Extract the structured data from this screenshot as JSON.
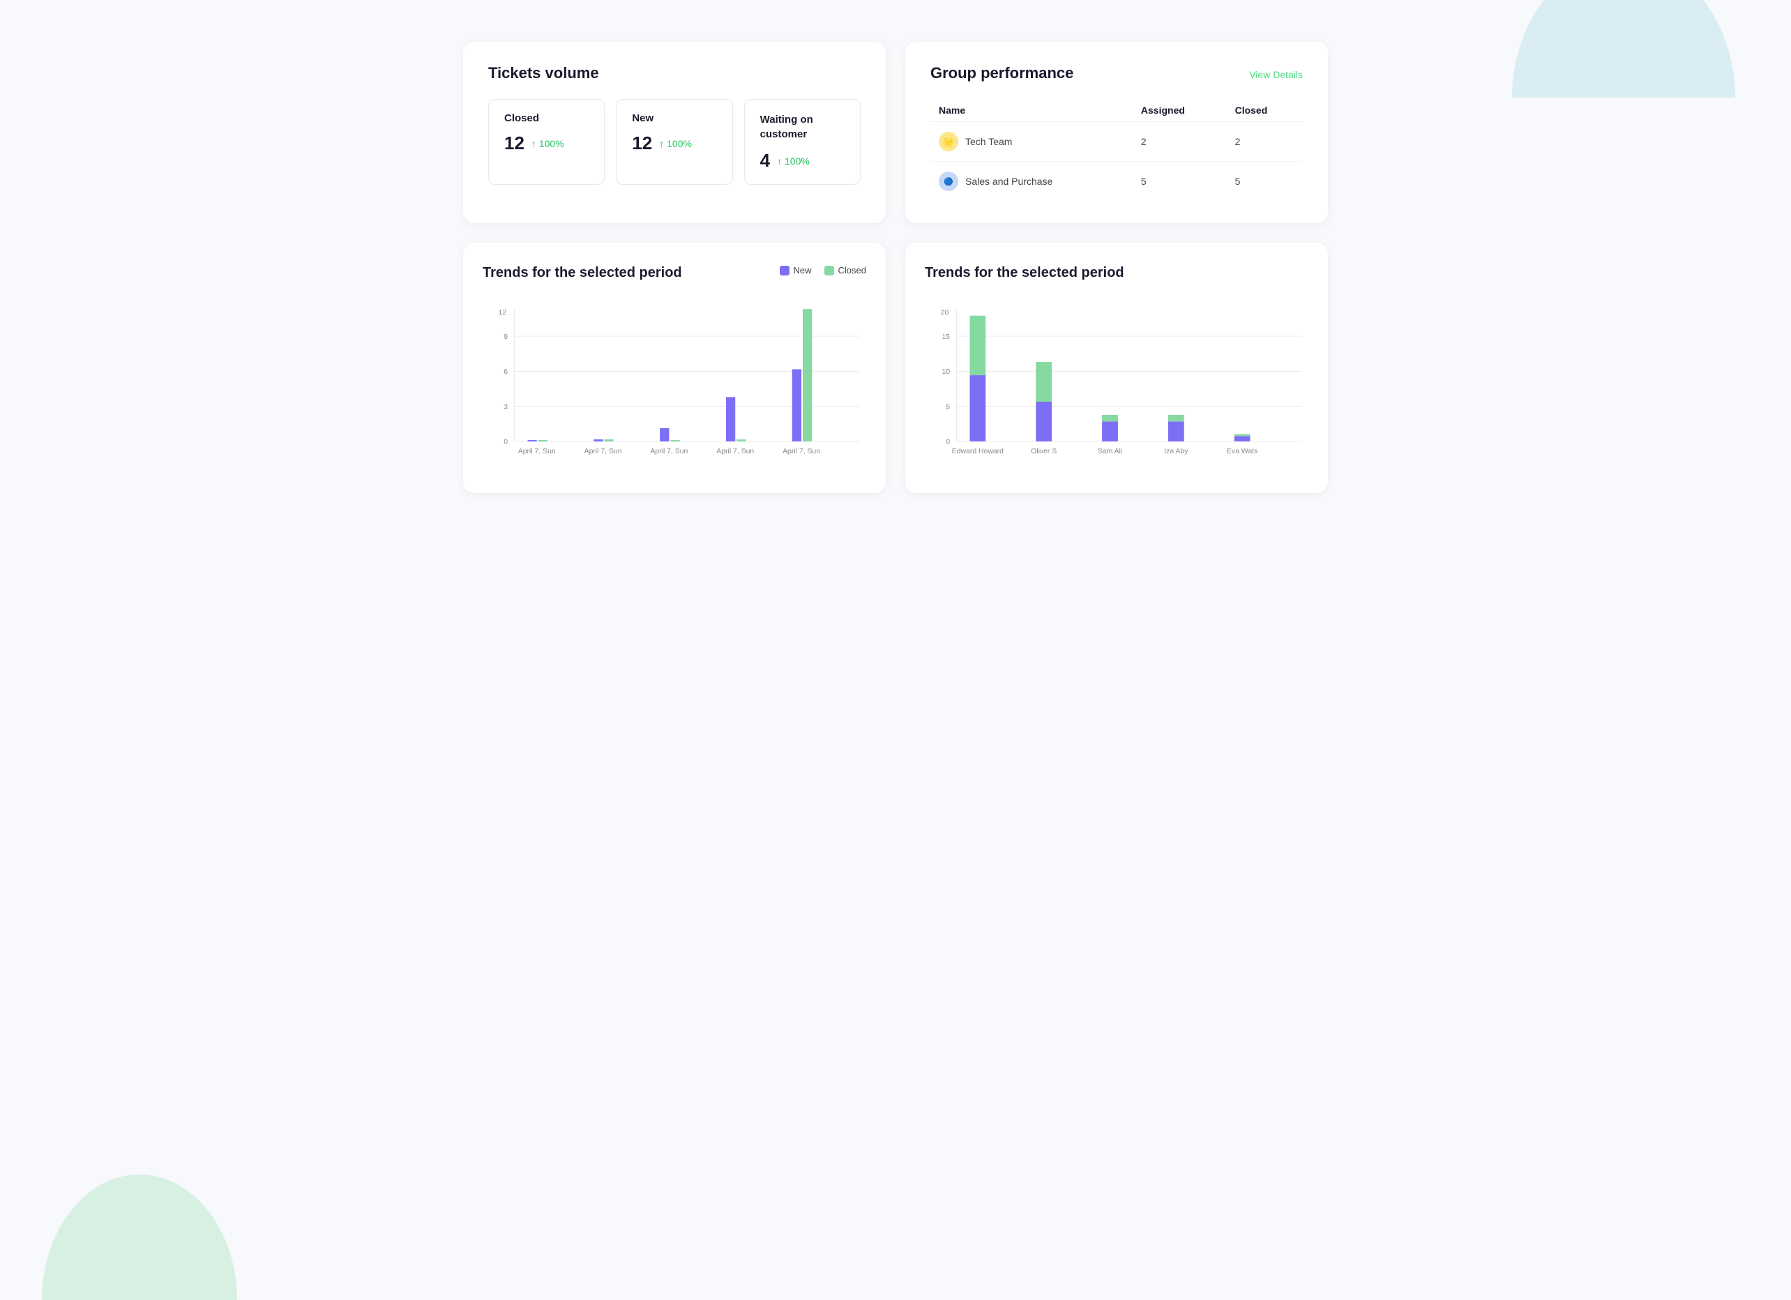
{
  "background": {
    "circle_top_right": "decorative",
    "circle_bottom_left": "decorative"
  },
  "tickets_volume": {
    "title": "Tickets volume",
    "metrics": [
      {
        "label": "Closed",
        "value": "12",
        "change": "↑ 100%"
      },
      {
        "label": "New",
        "value": "12",
        "change": "↑ 100%"
      },
      {
        "label": "Waiting on\ncustomer",
        "value": "4",
        "change": "↑ 100%"
      }
    ]
  },
  "group_performance": {
    "title": "Group performance",
    "view_details_label": "View Details",
    "columns": [
      "Name",
      "Assigned",
      "Closed"
    ],
    "rows": [
      {
        "name": "Tech Team",
        "avatar_emoji": "🌟",
        "avatar_color": "#fde68a",
        "assigned": "2",
        "closed": "2"
      },
      {
        "name": "Sales and Purchase",
        "avatar_emoji": "🔵",
        "avatar_color": "#c7d7f8",
        "assigned": "5",
        "closed": "5"
      }
    ]
  },
  "trends_chart_1": {
    "title": "Trends for the selected period",
    "legend": {
      "new_label": "New",
      "closed_label": "Closed"
    },
    "y_axis": [
      0,
      3,
      6,
      9,
      12
    ],
    "x_labels": [
      "April 7, Sun",
      "April 7, Sun",
      "April 7, Sun",
      "April 7, Sun",
      "April 7, Sun"
    ],
    "bars": [
      {
        "new": 0.1,
        "closed": 0.1
      },
      {
        "new": 0.2,
        "closed": 0.2
      },
      {
        "new": 1.2,
        "closed": 0.1
      },
      {
        "new": 4.0,
        "closed": 0.2
      },
      {
        "new": 6.5,
        "closed": 12.0
      }
    ],
    "max_value": 12
  },
  "trends_chart_2": {
    "title": "Trends for the selected period",
    "y_axis": [
      0,
      5,
      10,
      15,
      20
    ],
    "x_labels": [
      "Edward Howard",
      "Oliver S",
      "Sam Ali",
      "Iza Aby",
      "Eva Wats"
    ],
    "bars": [
      {
        "new": 10,
        "closed": 9
      },
      {
        "new": 6,
        "closed": 6
      },
      {
        "new": 3,
        "closed": 1
      },
      {
        "new": 3,
        "closed": 1
      },
      {
        "new": 0.8,
        "closed": 0.3
      }
    ],
    "max_value": 20
  }
}
